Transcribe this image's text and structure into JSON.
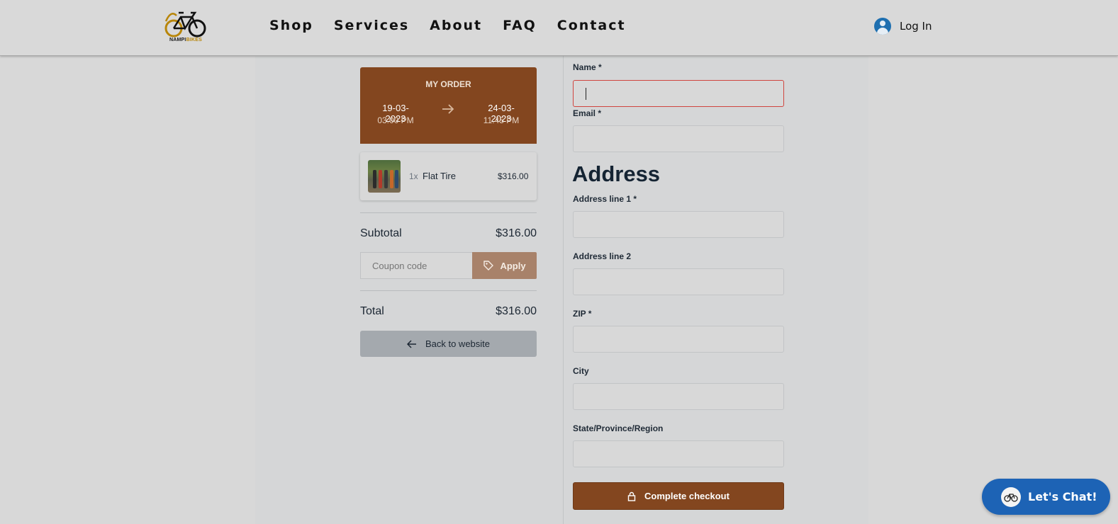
{
  "header": {
    "logo": {
      "name_part1": "NAMPI",
      "name_part2": "BIKES"
    },
    "nav": [
      "Shop",
      "Services",
      "About",
      "FAQ",
      "Contact"
    ],
    "login_label": "Log In"
  },
  "order": {
    "title": "MY ORDER",
    "start_date": "19-03-2023",
    "start_time": "03:00 PM",
    "end_date": "24-03-2023",
    "end_time": "11:45 PM",
    "items": [
      {
        "qty": "1x",
        "name": "Flat Tire",
        "price": "$316.00"
      }
    ],
    "subtotal_label": "Subtotal",
    "subtotal_value": "$316.00",
    "coupon_placeholder": "Coupon code",
    "apply_label": "Apply",
    "total_label": "Total",
    "total_value": "$316.00",
    "back_label": "Back to website"
  },
  "form": {
    "name_label": "Name *",
    "email_label": "Email *",
    "address_heading": "Address",
    "address1_label": "Address line 1 *",
    "address2_label": "Address line 2",
    "zip_label": "ZIP *",
    "city_label": "City",
    "state_label": "State/Province/Region",
    "checkout_label": "Complete checkout"
  },
  "chat": {
    "label": "Let's Chat!"
  },
  "colors": {
    "brand": "#83461f",
    "chat": "#1d63b5",
    "error": "#d0453f"
  }
}
